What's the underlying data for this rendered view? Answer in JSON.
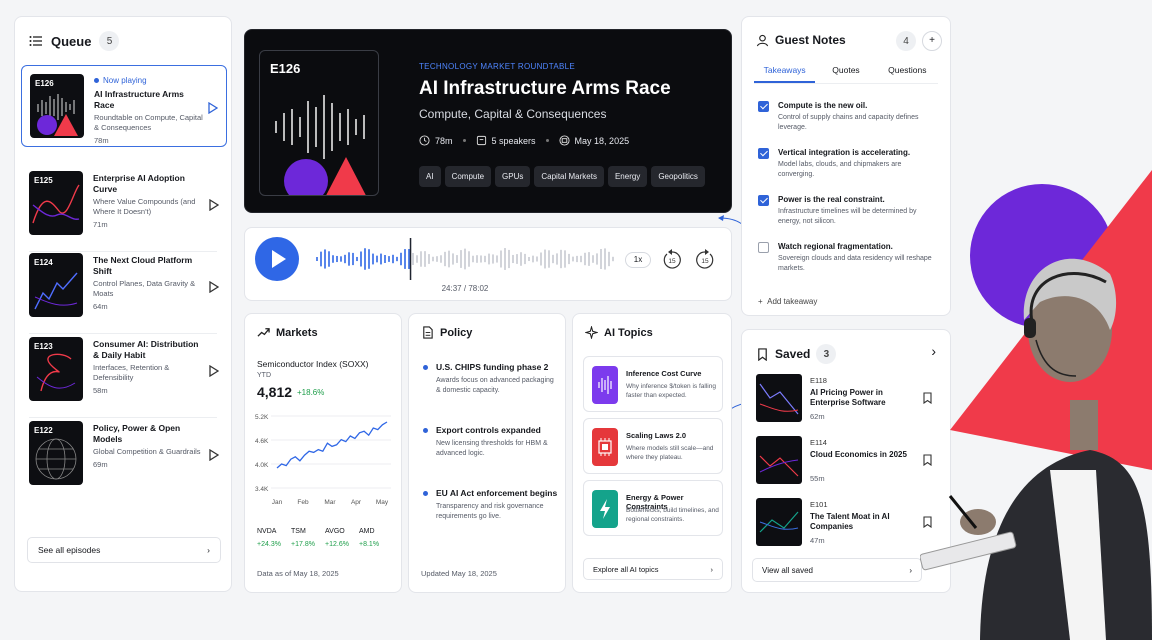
{
  "queue": {
    "title": "Queue",
    "count": "5",
    "see_all": "See all episodes",
    "episodes": [
      {
        "code": "E126",
        "status": "Now playing",
        "title": "AI Infrastructure Arms Race",
        "subtitle": "Roundtable on Compute, Capital & Consequences",
        "duration": "78m"
      },
      {
        "code": "E125",
        "title": "Enterprise AI Adoption Curve",
        "subtitle": "Where Value Compounds (and Where It Doesn't)",
        "duration": "71m"
      },
      {
        "code": "E124",
        "title": "The Next Cloud Platform Shift",
        "subtitle": "Control Planes, Data Gravity & Moats",
        "duration": "64m"
      },
      {
        "code": "E123",
        "title": "Consumer AI: Distribution & Daily Habit",
        "subtitle": "Interfaces, Retention & Defensibility",
        "duration": "58m"
      },
      {
        "code": "E122",
        "title": "Policy, Power & Open Models",
        "subtitle": "Global Competition & Guardrails",
        "duration": "69m"
      }
    ]
  },
  "hero": {
    "code": "E126",
    "kicker": "TECHNOLOGY MARKET ROUNDTABLE",
    "title": "AI Infrastructure Arms Race",
    "subtitle": "Compute, Capital & Consequences",
    "duration": "78m",
    "speakers": "5 speakers",
    "date": "May 18, 2025",
    "tags": [
      "AI",
      "Compute",
      "GPUs",
      "Capital Markets",
      "Energy",
      "Geopolitics"
    ]
  },
  "player": {
    "current": "24:37",
    "separator": "/",
    "total": "78:02",
    "speed": "1x",
    "skip_back": "15",
    "skip_forward": "15",
    "progress": 0.316
  },
  "markets": {
    "title": "Markets",
    "index_name": "Semiconductor Index (SOXX)",
    "period": "YTD",
    "value": "4,812",
    "change": "+18.6%",
    "tickers": [
      {
        "sym": "NVDA",
        "chg": "+24.3%"
      },
      {
        "sym": "TSM",
        "chg": "+17.8%"
      },
      {
        "sym": "AVGO",
        "chg": "+12.6%"
      },
      {
        "sym": "AMD",
        "chg": "+8.1%"
      }
    ],
    "as_of": "Data as of May 18, 2025"
  },
  "chart_data": {
    "type": "line",
    "categories": [
      "Jan",
      "Feb",
      "Mar",
      "Apr",
      "May"
    ],
    "ylim": [
      3400,
      5200
    ],
    "y_ticks": [
      "5.2K",
      "4.6K",
      "4.0K",
      "3.4K"
    ],
    "series": [
      {
        "values": [
          3900,
          4000,
          3960,
          4120,
          4180,
          4080,
          4220,
          4320,
          4290,
          4360,
          4320,
          4520,
          4440,
          4480,
          4610,
          4560,
          4700,
          4640,
          4780,
          4820,
          4720,
          4900,
          4860,
          4980,
          5050
        ]
      }
    ]
  },
  "policy": {
    "title": "Policy",
    "items": [
      {
        "title": "U.S. CHIPS funding phase 2",
        "desc": "Awards focus on advanced packaging & domestic capacity."
      },
      {
        "title": "Export controls expanded",
        "desc": "New licensing thresholds for HBM & advanced logic."
      },
      {
        "title": "EU AI Act enforcement begins",
        "desc": "Transparency and risk governance requirements go live."
      }
    ],
    "updated": "Updated May 18, 2025"
  },
  "topics": {
    "title": "AI Topics",
    "items": [
      {
        "title": "Inference Cost Curve",
        "desc": "Why inference $/token is falling faster than expected.",
        "color": "#7c3aed"
      },
      {
        "title": "Scaling Laws 2.0",
        "desc": "Where models still scale—and where they plateau.",
        "color": "#e5383b"
      },
      {
        "title": "Energy & Power Constraints",
        "desc": "Bottlenecks, build timelines, and regional constraints.",
        "color": "#14a38b"
      }
    ],
    "explore": "Explore all AI topics"
  },
  "notes": {
    "title": "Guest Notes",
    "count": "4",
    "tabs": [
      "Takeaways",
      "Quotes",
      "Questions"
    ],
    "items": [
      {
        "title": "Compute is the new oil.",
        "desc": "Control of supply chains and capacity defines leverage.",
        "checked": true
      },
      {
        "title": "Vertical integration is accelerating.",
        "desc": "Model labs, clouds, and chipmakers are converging.",
        "checked": true
      },
      {
        "title": "Power is the real constraint.",
        "desc": "Infrastructure timelines will be determined by energy, not silicon.",
        "checked": true
      },
      {
        "title": "Watch regional fragmentation.",
        "desc": "Sovereign clouds and data residency will reshape markets.",
        "checked": false
      }
    ],
    "add": "Add takeaway"
  },
  "saved": {
    "title": "Saved",
    "count": "3",
    "items": [
      {
        "code": "E118",
        "title": "AI Pricing Power in Enterprise Software",
        "duration": "62m"
      },
      {
        "code": "E114",
        "title": "Cloud Economics in 2025",
        "duration": "55m"
      },
      {
        "code": "E101",
        "title": "The Talent Moat in AI Companies",
        "duration": "47m"
      }
    ],
    "view_all": "View all saved"
  },
  "colors": {
    "accent": "#2f67e6",
    "purple": "#6d28d9",
    "red": "#f03a4a",
    "green": "#1e9e4a"
  }
}
